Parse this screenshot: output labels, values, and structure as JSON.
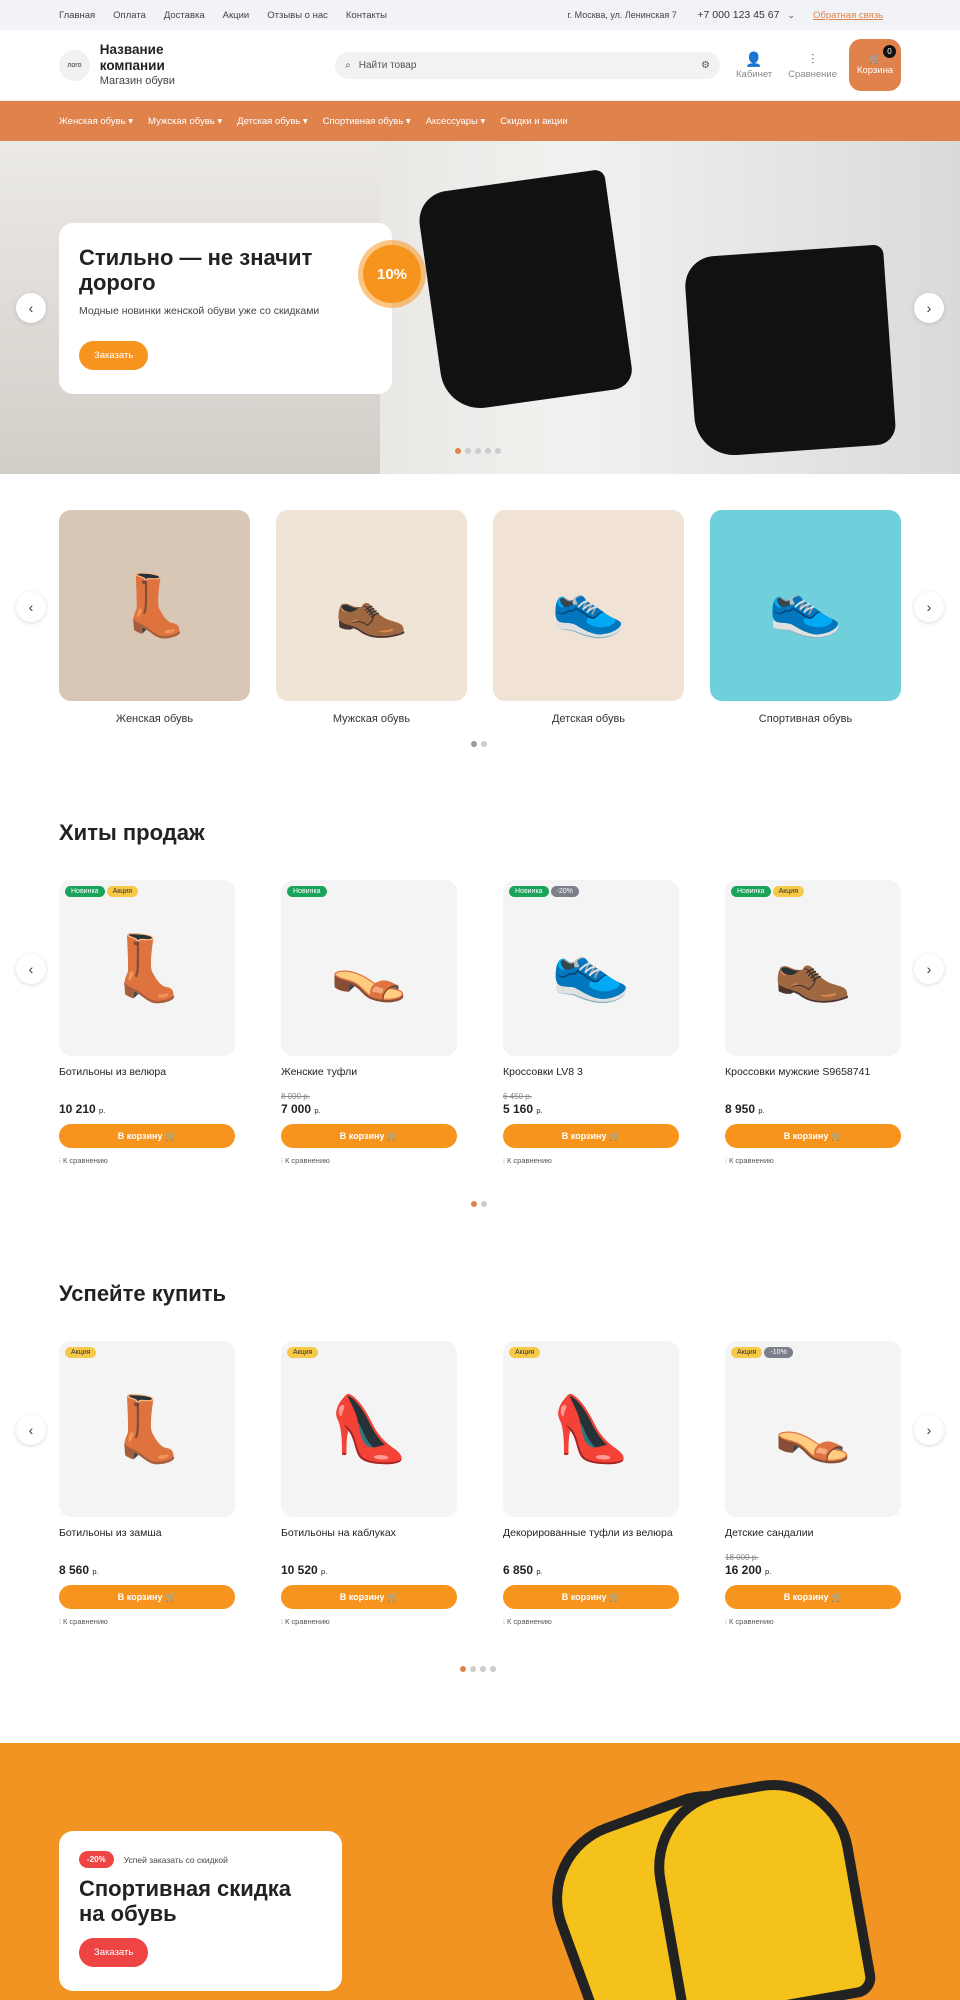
{
  "topbar": {
    "links": [
      "Главная",
      "Оплата",
      "Доставка",
      "Акции",
      "Отзывы о нас",
      "Контакты"
    ],
    "address": "г. Москва, ул. Ленинская 7",
    "phone": "+7 000 123 45 67",
    "callback": "Обратная связь"
  },
  "header": {
    "logo": "лого",
    "company_name": "Название компании",
    "company_sub": "Магазин обуви",
    "search_placeholder": "Найти товар",
    "cabinet": "Кабинет",
    "compare": "Сравнение",
    "cart": "Корзина",
    "cart_count": "0"
  },
  "nav": [
    "Женская обувь ▾",
    "Мужская обувь ▾",
    "Детская обувь ▾",
    "Спортивная обувь ▾",
    "Аксессуары ▾",
    "Скидки и акции"
  ],
  "hero": {
    "title": "Стильно — не значит дорого",
    "subtitle": "Модные новинки женской обуви уже со скидками",
    "button": "Заказать",
    "badge": "10%"
  },
  "categories": [
    {
      "label": "Женская обувь",
      "bg": "#d9c7b5"
    },
    {
      "label": "Мужская обувь",
      "bg": "#efe4d6"
    },
    {
      "label": "Детская обувь",
      "bg": "#f1e2d6"
    },
    {
      "label": "Спортивная обувь",
      "bg": "#6fd0dc"
    }
  ],
  "hits": {
    "title": "Хиты продаж",
    "items": [
      {
        "name": "Ботильоны из велюра",
        "old": "",
        "price": "10 210",
        "cur": "р.",
        "tags": [
          "Новинка",
          "Акция"
        ],
        "icon": "👢"
      },
      {
        "name": "Женские туфли",
        "old": "8 000 р.",
        "price": "7 000",
        "cur": "р.",
        "tags": [
          "Новинка"
        ],
        "icon": "👡"
      },
      {
        "name": "Кроссовки LV8 3",
        "old": "6 450 р.",
        "price": "5 160",
        "cur": "р.",
        "tags": [
          "Новинка",
          "-20%"
        ],
        "icon": "👟"
      },
      {
        "name": "Кроссовки мужские S9658741",
        "old": "",
        "price": "8 950",
        "cur": "р.",
        "tags": [
          "Новинка",
          "Акция"
        ],
        "icon": "👞"
      }
    ]
  },
  "hurry": {
    "title": "Успейте купить",
    "items": [
      {
        "name": "Ботильоны из замша",
        "old": "",
        "price": "8 560",
        "cur": "р.",
        "tags": [
          "Акция"
        ],
        "icon": "👢"
      },
      {
        "name": "Ботильоны на каблуках",
        "old": "",
        "price": "10 520",
        "cur": "р.",
        "tags": [
          "Акция"
        ],
        "icon": "👠"
      },
      {
        "name": "Декорированные туфли из велюра",
        "old": "",
        "price": "6 850",
        "cur": "р.",
        "tags": [
          "Акция"
        ],
        "icon": "👠"
      },
      {
        "name": "Детские сандалии",
        "old": "18 000 р.",
        "price": "16 200",
        "cur": "р.",
        "tags": [
          "Акция",
          "-10%"
        ],
        "icon": "👡"
      }
    ]
  },
  "product_ui": {
    "cart_button": "В корзину",
    "compare": "К сравнению"
  },
  "banner": {
    "badge": "-20%",
    "note": "Успей заказать со скидкой",
    "title": "Спортивная скидка на обувь",
    "button": "Заказать"
  }
}
